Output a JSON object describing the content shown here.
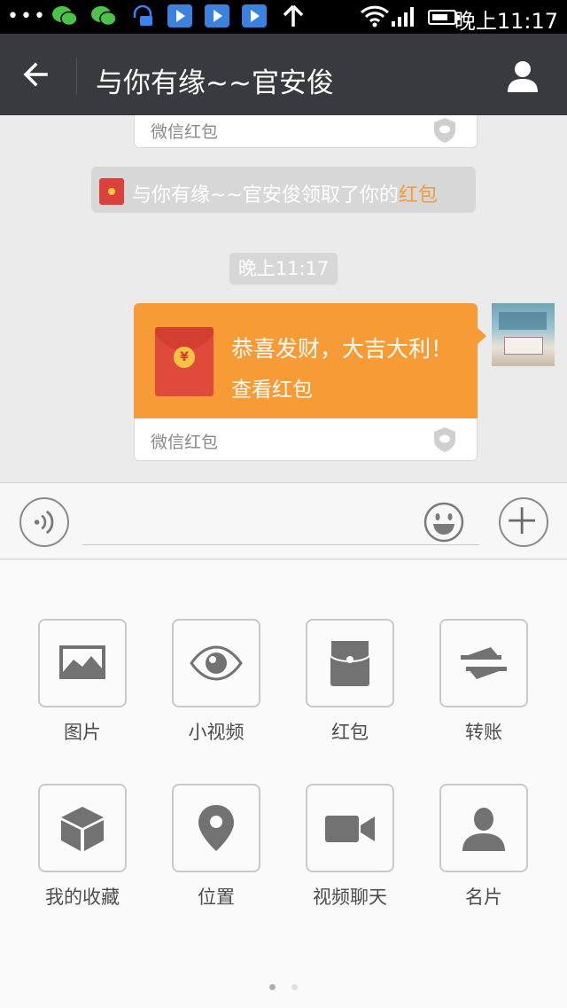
{
  "status_bar": {
    "dots": "•••",
    "time": "晚上11:17"
  },
  "header": {
    "title": "与你有缘~~官安俊"
  },
  "chat": {
    "previous_card_label": "微信红包",
    "system_message": {
      "prefix": "与你有缘~~官安俊领取了你的",
      "link": "红包"
    },
    "timestamp": "晚上11:17",
    "red_packet": {
      "title": "恭喜发财，大吉大利！",
      "action": "查看红包",
      "footer": "微信红包",
      "coin": "¥"
    }
  },
  "input": {
    "value": "",
    "placeholder": ""
  },
  "panel": {
    "items": [
      {
        "label": "图片",
        "icon": "image-icon"
      },
      {
        "label": "小视频",
        "icon": "eye-icon"
      },
      {
        "label": "红包",
        "icon": "red-packet-icon"
      },
      {
        "label": "转账",
        "icon": "transfer-icon"
      },
      {
        "label": "我的收藏",
        "icon": "cube-icon"
      },
      {
        "label": "位置",
        "icon": "location-pin-icon"
      },
      {
        "label": "视频聊天",
        "icon": "video-camera-icon"
      },
      {
        "label": "名片",
        "icon": "person-card-icon"
      }
    ],
    "page_indicator": {
      "total": 2,
      "current": 1
    }
  },
  "colors": {
    "header_bg": "#393a3f",
    "red_packet_orange": "#f79b37",
    "link_orange": "#f39c36",
    "chat_bg": "#ebebeb"
  }
}
